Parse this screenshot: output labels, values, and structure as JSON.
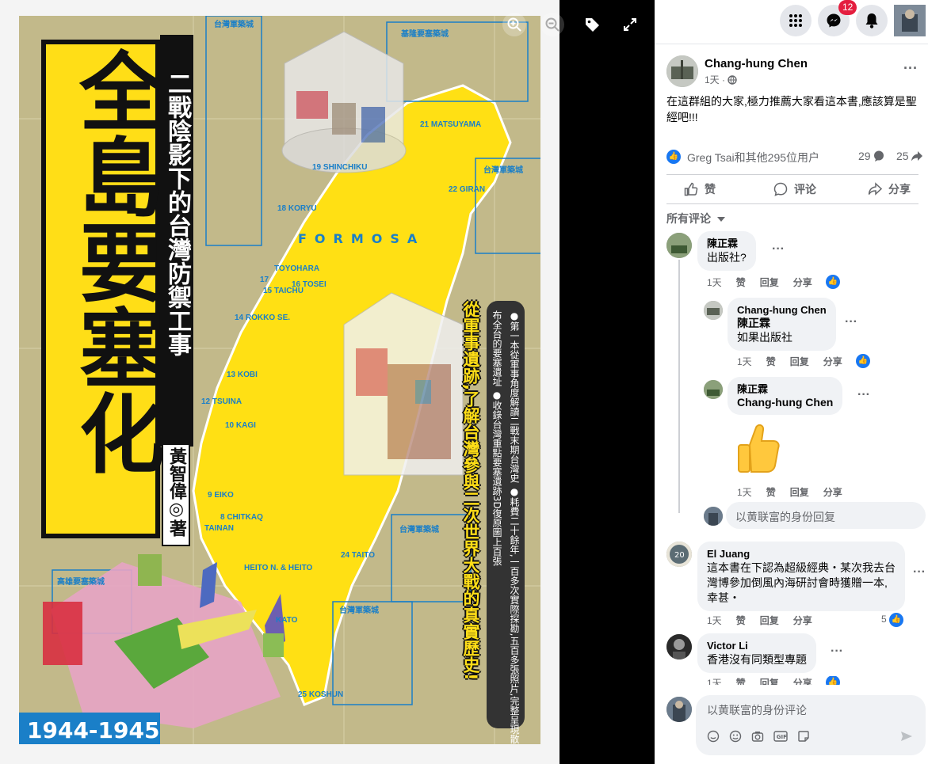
{
  "cover": {
    "title": "全島要塞化",
    "subtitle": "二戰陰影下的台灣防禦工事",
    "author": "黃智偉◎著",
    "years": "1944-1945",
    "formosa": "FORMOSA",
    "tagline": "從軍事遺跡,了解台灣參與二次世界大戰的真實歷史!",
    "blurb": "●第一本從軍事角度解讀二戰末期台灣史 ●耗費二十餘年,一百多次實際探勘,五百多張照片,完整呈現散布全台的要塞遺址 ●收錄台灣重點要塞遺跡3D復原圖上百張",
    "places": [
      "台灣軍築城",
      "基隆要塞築城",
      "台灣軍築城",
      "台灣軍築城",
      "高雄要塞築城",
      "台灣軍築城",
      "21 MATSUYAMA",
      "19 SHINCHIKU",
      "22 GIRAN",
      "18 KORYU",
      "TOYOHARA",
      "17",
      "16 TOSEI",
      "15 TAICHU",
      "14 ROKKO SE.",
      "13 KOBI",
      "12 TSUINA",
      "10 KAGI",
      "9 EIKO",
      "8 CHITKAQ",
      "TAINAN",
      "HEITO N. & HEITO",
      "24 TAITO",
      "KATO",
      "25 KOSHUN"
    ]
  },
  "viewer": {
    "zoom_in": "⊕",
    "zoom_out": "⊖",
    "tag_icon": "tag-icon",
    "fullscreen_icon": "fullscreen-icon"
  },
  "topbar": {
    "menu_icon": "grid-menu-icon",
    "messenger_icon": "messenger-icon",
    "notifications_icon": "bell-icon",
    "messenger_badge": "12"
  },
  "post": {
    "author": "Chang-hung Chen",
    "time": "1天 ·",
    "text": "在這群組的大家,極力推薦大家看這本書,應該算是聖經吧!!!",
    "reactions_text": "Greg Tsai和其他295位用户",
    "comments_count": "29",
    "shares_count": "25",
    "like_label": "赞",
    "comment_label": "评论",
    "share_label": "分享",
    "filter_label": "所有评论"
  },
  "comments": [
    {
      "name": "陳正霖",
      "text": "出版社?",
      "time": "1天",
      "like": "赞",
      "reply": "回复",
      "share": "分享"
    },
    {
      "name": "Chang-hung Chen",
      "mention": "陳正霖",
      "text": "如果出版社",
      "time": "1天",
      "like": "赞",
      "reply": "回复",
      "share": "分享"
    },
    {
      "name": "陳正霖",
      "mention": "Chang-hung Chen",
      "text": "",
      "time": "1天",
      "like": "赞",
      "reply": "回复",
      "share": "分享"
    },
    {
      "name": "El Juang",
      "text": "這本書在下認為超級經典・某次我去台灣博參加倒風內海研討會時獲贈一本,幸甚・",
      "time": "1天",
      "like": "赞",
      "reply": "回复",
      "share": "分享",
      "likes": "5"
    },
    {
      "name": "Victor Li",
      "text": "香港沒有同類型專題",
      "time": "1天",
      "like": "赞",
      "reply": "回复",
      "share": "分享"
    }
  ],
  "reply_placeholder": "以黄联富的身份回复",
  "comment_placeholder": "以黄联富的身份评论",
  "colors": {
    "brand": "#1877f2",
    "cover_yellow": "#ffde17",
    "cover_blue": "#1a7fc8"
  }
}
